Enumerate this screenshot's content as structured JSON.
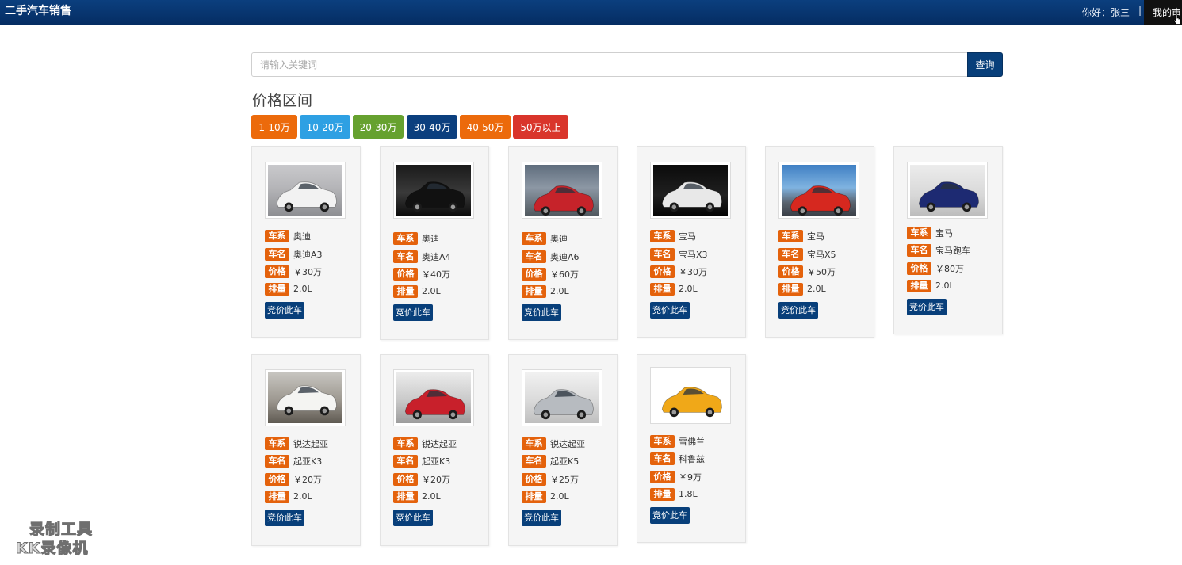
{
  "header": {
    "brand": "二手汽车销售",
    "greeting": "你好：张三",
    "separator": "|",
    "my_orders": "我的审"
  },
  "search": {
    "placeholder": "请输入关键词",
    "button": "查询"
  },
  "price_range": {
    "title": "价格区间",
    "buttons": [
      {
        "label": "1-10万",
        "color": "#ec6a0b"
      },
      {
        "label": "10-20万",
        "color": "#2ea0e3"
      },
      {
        "label": "20-30万",
        "color": "#66a12f"
      },
      {
        "label": "30-40万",
        "color": "#0b3f7e"
      },
      {
        "label": "40-50万",
        "color": "#ec6a0b"
      },
      {
        "label": "50万以上",
        "color": "#d9352b"
      }
    ]
  },
  "labels": {
    "series": "车系",
    "name": "车名",
    "price": "价格",
    "displacement": "排量",
    "bid": "竞价此车"
  },
  "cars": [
    {
      "series": "奥迪",
      "name": "奥迪A3",
      "price": "￥30万",
      "displacement": "2.0L",
      "image": "white-sedan"
    },
    {
      "series": "奥迪",
      "name": "奥迪A4",
      "price": "￥40万",
      "displacement": "2.0L",
      "image": "black-sedan"
    },
    {
      "series": "奥迪",
      "name": "奥迪A6",
      "price": "￥60万",
      "displacement": "2.0L",
      "image": "red-sedan"
    },
    {
      "series": "宝马",
      "name": "宝马X3",
      "price": "￥30万",
      "displacement": "2.0L",
      "image": "white-sedan-dark"
    },
    {
      "series": "宝马",
      "name": "宝马X5",
      "price": "￥50万",
      "displacement": "2.0L",
      "image": "red-coupe"
    },
    {
      "series": "宝马",
      "name": "宝马跑车",
      "price": "￥80万",
      "displacement": "2.0L",
      "image": "blue-convertible"
    },
    {
      "series": "锐达起亚",
      "name": "起亚K3",
      "price": "￥20万",
      "displacement": "2.0L",
      "image": "white-sedan-desert"
    },
    {
      "series": "锐达起亚",
      "name": "起亚K3",
      "price": "￥20万",
      "displacement": "2.0L",
      "image": "red-showroom"
    },
    {
      "series": "锐达起亚",
      "name": "起亚K5",
      "price": "￥25万",
      "displacement": "2.0L",
      "image": "silver-showroom"
    },
    {
      "series": "雪佛兰",
      "name": "科鲁兹",
      "price": "￥9万",
      "displacement": "1.8L",
      "image": "yellow-hatch"
    }
  ],
  "watermark": {
    "line1": "录制工具",
    "line2": "KK录像机"
  }
}
